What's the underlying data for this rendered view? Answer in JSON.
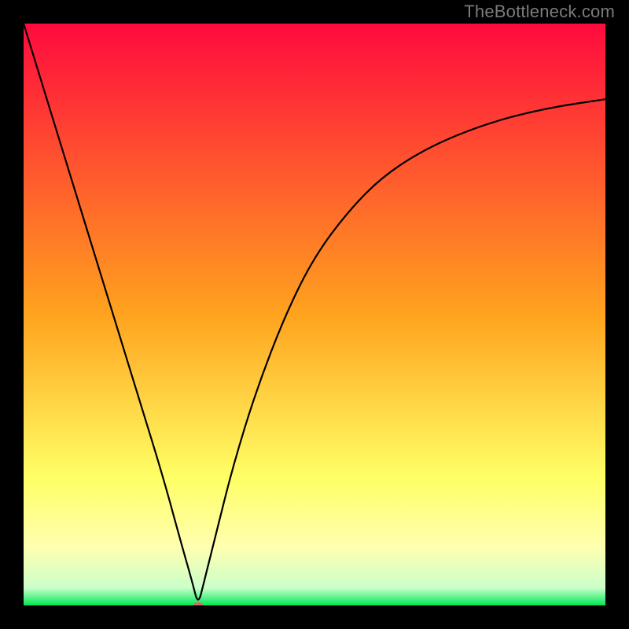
{
  "watermark": "TheBottleneck.com",
  "chart_data": {
    "type": "line",
    "title": "",
    "xlabel": "",
    "ylabel": "",
    "xlim": [
      0,
      100
    ],
    "ylim": [
      0,
      100
    ],
    "grid": false,
    "legend": false,
    "background_gradient": {
      "stops": [
        {
          "offset": 0.0,
          "color": "#ff0a3e"
        },
        {
          "offset": 0.5,
          "color": "#ffa31e"
        },
        {
          "offset": 0.78,
          "color": "#ffff66"
        },
        {
          "offset": 0.9,
          "color": "#ffffb0"
        },
        {
          "offset": 0.97,
          "color": "#caffca"
        },
        {
          "offset": 1.0,
          "color": "#00e756"
        }
      ]
    },
    "series": [
      {
        "name": "bottleneck-curve",
        "description": "V-shaped optimality curve; y≈0 is best match, higher y worse. Left branch nearly linear; right branch concave.",
        "x": [
          0,
          4,
          8,
          12,
          16,
          20,
          24,
          27,
          29,
          30,
          31,
          33,
          36,
          40,
          45,
          50,
          56,
          62,
          70,
          80,
          90,
          100
        ],
        "y": [
          100,
          87,
          74,
          61,
          48,
          35,
          22,
          11,
          4,
          0,
          4,
          12,
          24,
          37,
          50,
          60,
          68,
          74,
          79,
          83,
          85.5,
          87
        ]
      }
    ],
    "marker": {
      "x": 30,
      "y": 0,
      "color": "#d66a6a",
      "rx": 6,
      "ry": 4
    }
  }
}
